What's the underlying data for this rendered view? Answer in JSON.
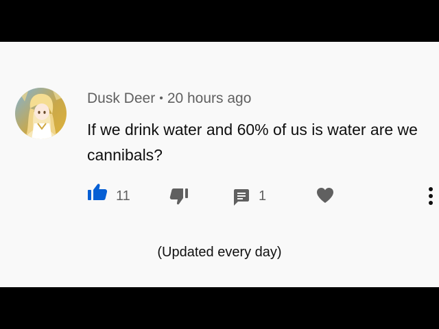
{
  "comment": {
    "author": "Dusk Deer",
    "separator": "•",
    "timestamp": "20 hours ago",
    "text": "If we drink water and 60% of us is water are we cannibals?",
    "avatar_icon": "anime-character-avatar"
  },
  "actions": {
    "like_icon": "thumbs-up-icon",
    "like_count": "11",
    "like_color": "#065fd4",
    "dislike_icon": "thumbs-down-icon",
    "reply_icon": "comment-icon",
    "reply_count": "1",
    "heart_icon": "heart-icon",
    "more_icon": "more-vertical-icon"
  },
  "footer": {
    "note": "(Updated every day)"
  }
}
